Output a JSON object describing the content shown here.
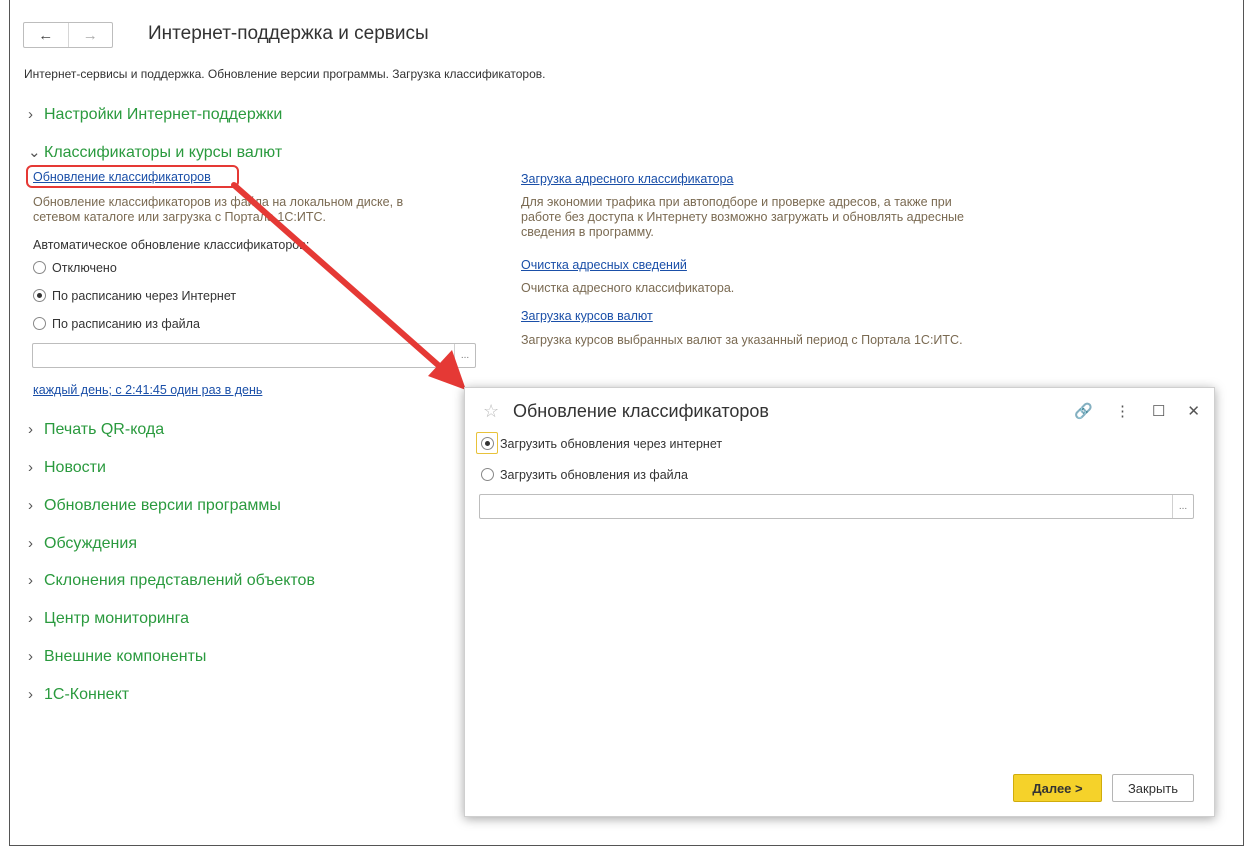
{
  "window": {
    "title": "Интернет-поддержка и сервисы",
    "back_icon": "←",
    "forward_icon": "→",
    "description": "Интернет-сервисы и поддержка. Обновление версии программы. Загрузка классификаторов."
  },
  "sections": {
    "internet_support": "Настройки Интернет-поддержки",
    "classifiers": "Классификаторы и курсы валют",
    "qr": "Печать QR-кода",
    "news": "Новости",
    "update": "Обновление версии программы",
    "discussions": "Обсуждения",
    "declensions": "Склонения представлений объектов",
    "monitoring": "Центр мониторинга",
    "external": "Внешние компоненты",
    "connect": "1С-Коннект"
  },
  "classifiers": {
    "update_link": "Обновление классификаторов",
    "update_note": "Обновление классификаторов из файла на локальном диске, в сетевом каталоге или загрузка с Портала 1С:ИТС.",
    "auto_label": "Автоматическое обновление классификаторов:",
    "opt_off": "Отключено",
    "opt_internet": "По расписанию через Интернет",
    "opt_file": "По расписанию из файла",
    "file_path": "",
    "schedule_link": "каждый день; с 2:41:45 один раз в день",
    "address_link": "Загрузка адресного классификатора",
    "address_note": "Для экономии трафика при автоподборе и проверке адресов, а также при работе без доступа к Интернету возможно загружать и обновлять адресные сведения в программу.",
    "clear_link": "Очистка адресных сведений",
    "clear_note": "Очистка адресного классификатора.",
    "currency_link": "Загрузка курсов валют",
    "currency_note": "Загрузка курсов выбранных валют за указанный период с Портала 1С:ИТС."
  },
  "dialog": {
    "title": "Обновление классификаторов",
    "opt_internet": "Загрузить обновления через интернет",
    "opt_file": "Загрузить обновления из файла",
    "file_path": "",
    "next_button": "Далее >",
    "close_button": "Закрыть"
  },
  "colors": {
    "section_green": "#2a9a3e",
    "link_blue": "#1a4fa8",
    "highlight_red": "#e53935",
    "primary_yellow": "#f5d22a"
  }
}
